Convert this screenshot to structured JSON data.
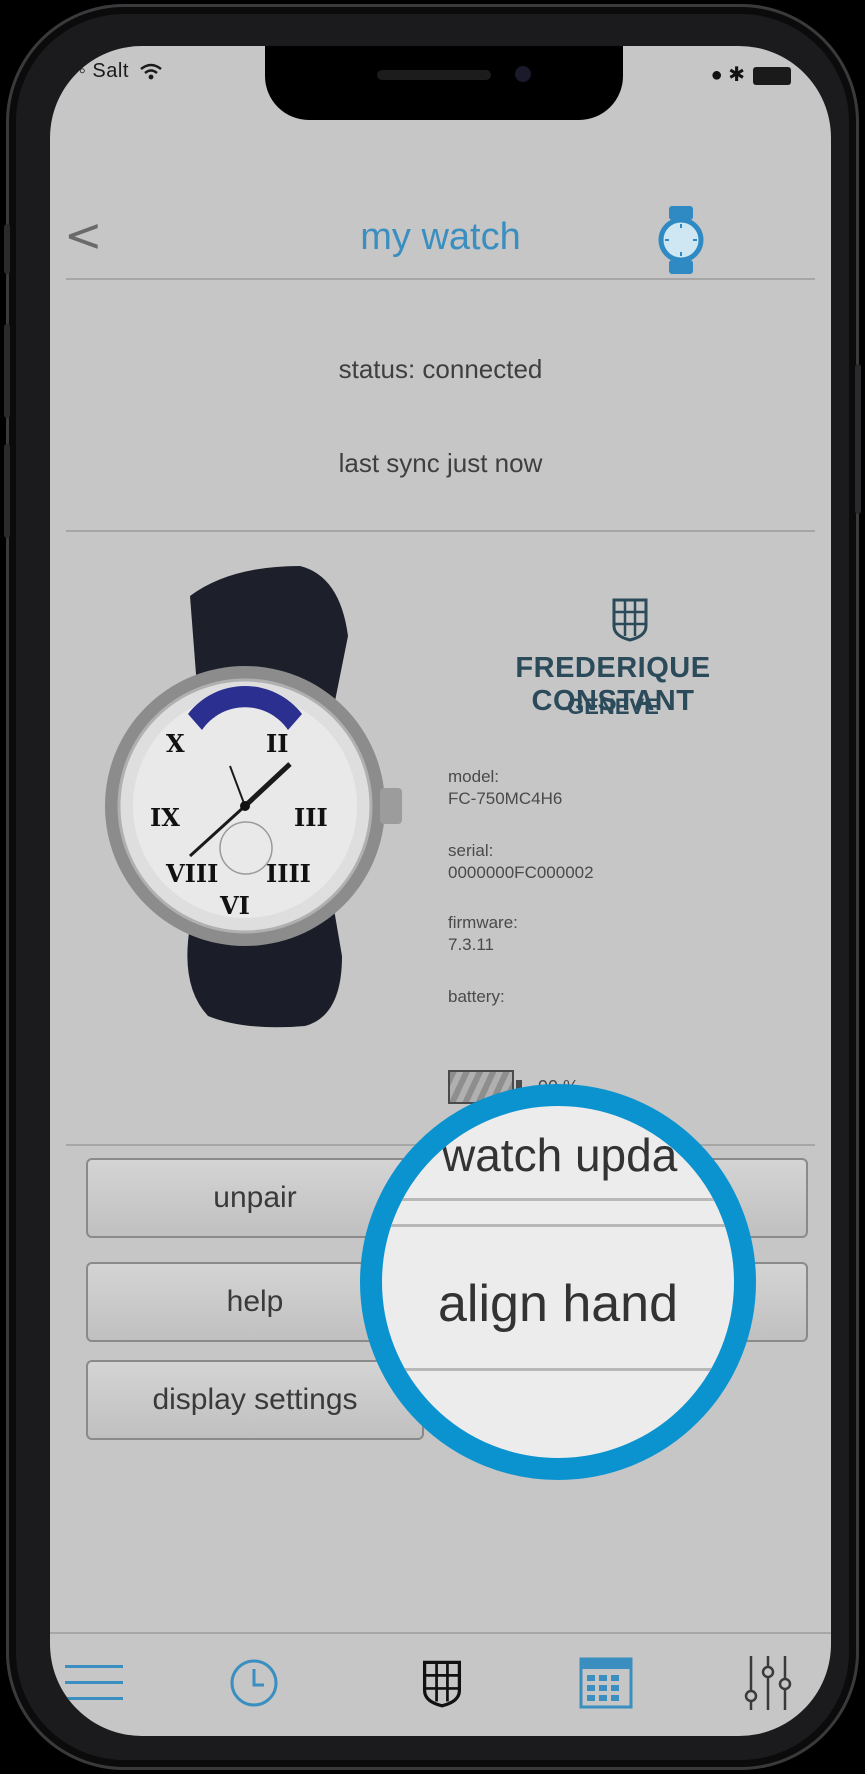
{
  "statusbar": {
    "carrier": "◦◦◦◦ Salt",
    "wifi": "wifi",
    "right_icons": "● ✱"
  },
  "nav": {
    "back": "<",
    "title": "my watch",
    "watch_icon": "watch-icon"
  },
  "connection": {
    "status": "status: connected",
    "last_sync": "last sync just now"
  },
  "brand": {
    "name": "FREDERIQUE CONSTANT",
    "sub": "GENEVE"
  },
  "specs": {
    "model_label": "model:",
    "model_value": "FC-750MC4H6",
    "serial_label": "serial:",
    "serial_value": "0000000FC000002",
    "firmware_label": "firmware:",
    "firmware_value": "7.3.11",
    "battery_label": "battery:",
    "battery_value": "90 %"
  },
  "buttons": {
    "unpair": "unpair",
    "help": "help",
    "display_settings": "display settings",
    "watch_update": "watch update",
    "align_hand": "align hand"
  },
  "magnifier": {
    "top_text": "watch upda",
    "main_text": "align hand"
  },
  "tabbar": [
    "menu-icon",
    "clock-icon",
    "brand-icon",
    "calendar-icon",
    "settings-sliders-icon"
  ],
  "colors": {
    "accent": "#0b93d0",
    "title": "#3a8fc0",
    "screen_bg": "#c6c6c6"
  }
}
